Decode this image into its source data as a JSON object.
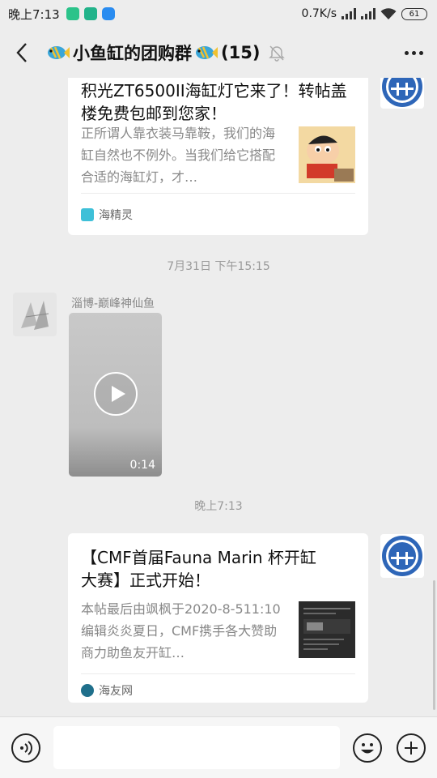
{
  "status_bar": {
    "time": "晚上7:13",
    "network_speed": "0.7K/s",
    "battery": "61",
    "icons": [
      "app-icon",
      "app-icon",
      "cloud-icon",
      "signal-icon",
      "signal-icon",
      "wifi-icon",
      "battery-icon"
    ]
  },
  "header": {
    "title": "小鱼缸的团购群",
    "member_count": "(15)",
    "icons": [
      "back-icon",
      "fish-icon",
      "mute-bell-icon",
      "more-icon"
    ]
  },
  "messages": [
    {
      "type": "link_card",
      "title": "积光ZT6500II海缸灯它来了！转帖盖楼免费包邮到您家！",
      "description": "正所谓人靠衣装马靠鞍，我们的海缸自然也不例外。当我们给它搭配合适的海缸灯，才…",
      "source": "海精灵"
    },
    {
      "type": "timestamp",
      "text": "7月31日 下午15:15"
    },
    {
      "type": "video",
      "sender": "淄博-巅峰神仙鱼",
      "duration": "0:14"
    },
    {
      "type": "timestamp",
      "text": "晚上7:13"
    },
    {
      "type": "link_card",
      "title": "【CMF首届Fauna Marin 杯开缸大赛】正式开始！",
      "description": "本帖最后由飒枫于2020-8-511:10编辑炎炎夏日，CMF携手各大赞助商力助鱼友开缸…",
      "source": "海友网"
    }
  ],
  "input_bar": {
    "placeholder": "",
    "icons": [
      "voice-icon",
      "emoji-icon",
      "plus-icon"
    ]
  },
  "colors": {
    "background": "#ededed",
    "card": "#ffffff",
    "avatar_blue": "#2e66b8"
  }
}
